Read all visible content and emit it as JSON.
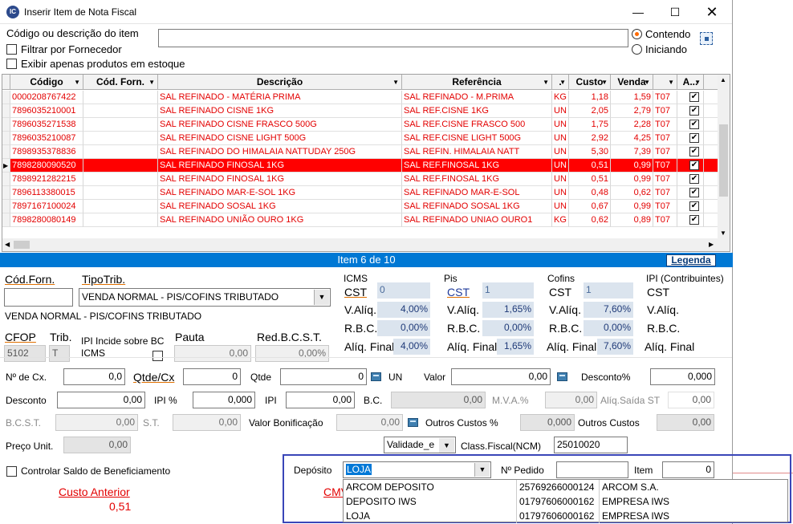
{
  "window": {
    "title": "Inserir Item de Nota Fiscal",
    "icon_text": "IC"
  },
  "search": {
    "label": "Código ou descrição do item",
    "value": "",
    "filter_supplier": "Filtrar por Fornecedor",
    "only_stock": "Exibir apenas produtos em estoque",
    "mode_contains": "Contendo",
    "mode_starts": "Iniciando"
  },
  "grid": {
    "headers": [
      "Código",
      "Cód. Forn.",
      "Descrição",
      "Referência",
      ".",
      "Custo",
      "Venda",
      "",
      "A...",
      ""
    ],
    "rows": [
      {
        "codigo": "0000208767422",
        "forn": "",
        "desc": "SAL REFINADO - MATÉRIA PRIMA",
        "ref": "SAL REFINADO - M.PRIMA",
        "un": "KG",
        "custo": "1,18",
        "venda": "1,59",
        "t": "T07",
        "ativo": "✔"
      },
      {
        "codigo": "7896035210001",
        "forn": "",
        "desc": "SAL REFINADO CISNE 1KG",
        "ref": "SAL REF.CISNE 1KG",
        "un": "UN",
        "custo": "2,05",
        "venda": "2,79",
        "t": "T07",
        "ativo": "✔"
      },
      {
        "codigo": "7896035271538",
        "forn": "",
        "desc": "SAL REFINADO CISNE FRASCO 500G",
        "ref": "SAL REF.CISNE FRASCO 500",
        "un": "UN",
        "custo": "1,75",
        "venda": "2,28",
        "t": "T07",
        "ativo": "✔"
      },
      {
        "codigo": "7896035210087",
        "forn": "",
        "desc": "SAL REFINADO CISNE LIGHT 500G",
        "ref": "SAL REF.CISNE LIGHT 500G",
        "un": "UN",
        "custo": "2,92",
        "venda": "4,25",
        "t": "T07",
        "ativo": "✔"
      },
      {
        "codigo": "7898935378836",
        "forn": "",
        "desc": "SAL REFINADO DO HIMALAIA NATTUDAY 250G",
        "ref": "SAL REFIN. HIMALAIA NATT",
        "un": "UN",
        "custo": "5,30",
        "venda": "7,39",
        "t": "T07",
        "ativo": "✔"
      },
      {
        "codigo": "7898280090520",
        "forn": "",
        "desc": "SAL REFINADO FINOSAL 1KG",
        "ref": "SAL REF.FINOSAL 1KG",
        "un": "UN",
        "custo": "0,51",
        "venda": "0,99",
        "t": "T07",
        "ativo": "✔"
      },
      {
        "codigo": "7898921282215",
        "forn": "",
        "desc": "SAL REFINADO FINOSAL 1KG",
        "ref": "SAL REF.FINOSAL 1KG",
        "un": "UN",
        "custo": "0,51",
        "venda": "0,99",
        "t": "T07",
        "ativo": "✔"
      },
      {
        "codigo": "7896113380015",
        "forn": "",
        "desc": "SAL REFINADO MAR-E-SOL 1KG",
        "ref": "SAL REFINADO MAR-E-SOL",
        "un": "UN",
        "custo": "0,48",
        "venda": "0,62",
        "t": "T07",
        "ativo": "✔"
      },
      {
        "codigo": "7897167100024",
        "forn": "",
        "desc": "SAL REFINADO SOSAL 1KG",
        "ref": "SAL REFINADO SOSAL 1KG",
        "un": "UN",
        "custo": "0,67",
        "venda": "0,99",
        "t": "T07",
        "ativo": "✔"
      },
      {
        "codigo": "7898280080149",
        "forn": "",
        "desc": "SAL REFINADO UNIÃO OURO 1KG",
        "ref": "SAL REFINADO UNIAO OURO1",
        "un": "KG",
        "custo": "0,62",
        "venda": "0,89",
        "t": "T07",
        "ativo": "✔"
      }
    ]
  },
  "status": {
    "item_text": "Item 6 de 10",
    "legend": "Legenda"
  },
  "form": {
    "cod_forn_label": "Cód.Forn.",
    "cod_forn_value": "",
    "tipo_trib_label": "TipoTrib.",
    "tipo_trib_value": "VENDA NORMAL - PIS/COFINS TRIBUTADO",
    "tipo_trib_desc": "VENDA NORMAL - PIS/COFINS TRIBUTADO",
    "cfop_label": "CFOP",
    "cfop_value": "5102",
    "trib_label": "Trib.",
    "trib_value": "T",
    "ipi_incide": "IPI Incide sobre BC ICMS",
    "pauta_label": "Pauta",
    "pauta_value": "0,00",
    "red_bcst_label": "Red.B.C.S.T.",
    "red_bcst_value": "0,00%"
  },
  "icms": {
    "title": "ICMS",
    "cst_label": "CST",
    "cst": "0",
    "valiq_label": "V.Alíq.",
    "valiq": "4,00%",
    "rbc_label": "R.B.C.",
    "rbc": "0,00%",
    "aliq_final_label": "Alíq. Final",
    "aliq_final": "4,00%"
  },
  "pis": {
    "title": "Pis",
    "cst_label": "CST",
    "cst": "1",
    "valiq_label": "V.Alíq.",
    "valiq": "1,65%",
    "rbc_label": "R.B.C.",
    "rbc": "0,00%",
    "aliq_final_label": "Alíq. Final",
    "aliq_final": "1,65%"
  },
  "cofins": {
    "title": "Cofins",
    "cst_label": "CST",
    "cst": "1",
    "valiq_label": "V.Alíq.",
    "valiq": "7,60%",
    "rbc_label": "R.B.C.",
    "rbc": "0,00%",
    "aliq_final_label": "Alíq. Final",
    "aliq_final": "7,60%"
  },
  "ipi": {
    "title": "IPI (Contribuintes)",
    "cst_label": "CST",
    "valiq_label": "V.Alíq.",
    "rbc_label": "R.B.C.",
    "aliq_final_label": "Alíq. Final"
  },
  "values": {
    "n_cx_label": "Nº de Cx.",
    "n_cx": "0,0",
    "qtde_cx_label": "Qtde/Cx",
    "qtde_cx": "0",
    "qtde_label": "Qtde",
    "qtde": "0",
    "un": "UN",
    "valor_label": "Valor",
    "valor": "0,00",
    "desconto_pct_label": "Desconto%",
    "desconto_pct": "0,000",
    "desconto_label": "Desconto",
    "desconto": "0,00",
    "ipi_pct_label": "IPI %",
    "ipi_pct": "0,000",
    "ipi_label": "IPI",
    "ipi": "0,00",
    "bc_label": "B.C.",
    "bc": "0,00",
    "mva_label": "M.V.A.%",
    "mva": "0,00",
    "aliq_saida_st_label": "Alíq.Saída ST",
    "aliq_saida_st": "0,00",
    "bcst_label": "B.C.S.T.",
    "bcst": "0,00",
    "st_label": "S.T.",
    "st": "0,00",
    "valor_bonif_label": "Valor Bonificação",
    "valor_bonif": "0,00",
    "outros_custos_pct_label": "Outros Custos %",
    "outros_custos_pct": "0,000",
    "outros_custos_label": "Outros Custos",
    "outros_custos": "0,00",
    "preco_unit_label": "Preço Unit.",
    "preco_unit": "0,00",
    "validade_value": "Validade_e",
    "class_fiscal_label": "Class.Fiscal(NCM)",
    "class_fiscal": "25010020"
  },
  "bottom": {
    "controlar_saldo": "Controlar Saldo de Beneficiamento",
    "custo_anterior_label": "Custo Anterior",
    "custo_anterior": "0,51",
    "cmv_label": "CMV"
  },
  "deposito": {
    "label": "Depósito",
    "value": "LOJA",
    "pedido_label": "Nº Pedido",
    "pedido": "",
    "item_label": "Item",
    "item": "0",
    "options": [
      {
        "name": "ARCOM DEPOSITO",
        "cnpj": "25769266000124",
        "company": "ARCOM S.A."
      },
      {
        "name": "DEPOSITO IWS",
        "cnpj": "01797606000162",
        "company": "EMPRESA IWS"
      },
      {
        "name": "LOJA",
        "cnpj": "01797606000162",
        "company": "EMPRESA IWS"
      }
    ]
  },
  "colors": {
    "accent": "#0078d4",
    "row_text": "#e30000",
    "selected_row": "#ff0000",
    "panel_border": "#3a46b8"
  }
}
